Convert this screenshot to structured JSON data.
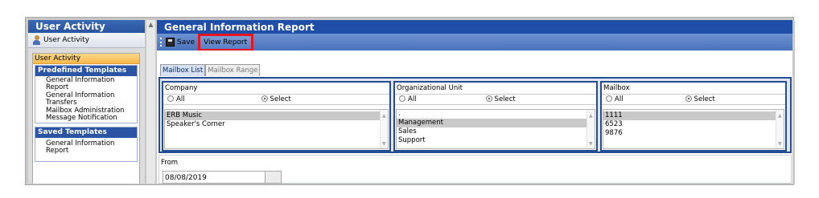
{
  "left_panel": {
    "title": "User Activity",
    "subheader": "User Activity",
    "category": "User Activity",
    "predefined_header": "Predefined Templates",
    "predefined_items": [
      "General Information Report",
      "General Information Transfers",
      "Mailbox Administration Message Notification"
    ],
    "saved_header": "Saved Templates",
    "saved_items": [
      "General Information Report"
    ]
  },
  "main": {
    "title": "General Information Report",
    "toolbar": {
      "save_label": "Save",
      "view_report_label": "View Report"
    },
    "tabs": [
      {
        "label": "Mailbox List",
        "active": true
      },
      {
        "label": "Mailbox Range",
        "active": false
      }
    ],
    "company": {
      "label": "Company",
      "radio_all": "All",
      "radio_select": "Select",
      "selected_radio": "Select",
      "items": [
        "ERB Music",
        "Speaker's Corner"
      ],
      "selected_item": "ERB Music"
    },
    "org_unit": {
      "label": "Organizational Unit",
      "radio_all": "All",
      "radio_select": "Select",
      "selected_radio": "Select",
      "items": [
        ".",
        "Management",
        "Sales",
        "Support"
      ],
      "selected_item": "Management"
    },
    "mailbox": {
      "label": "Mailbox",
      "radio_all": "All",
      "radio_select": "Select",
      "selected_radio": "Select",
      "items": [
        "1111",
        "6523",
        "9876"
      ],
      "selected_item": "1111"
    },
    "from": {
      "label": "From",
      "value": "08/08/2019"
    }
  },
  "colors": {
    "title_bar": "#1f4ea8",
    "toolbar": "#5880c6",
    "highlight_border": "#e8141e",
    "category_orange": "#f6b84a"
  }
}
